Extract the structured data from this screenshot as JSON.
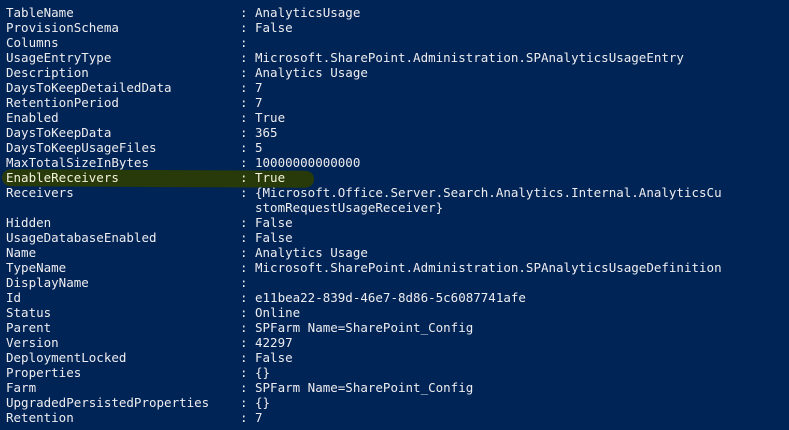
{
  "window": {
    "background": "#012456",
    "text_color": "#eeedf0",
    "highlight_color": "#2a3c06"
  },
  "separator": ":",
  "properties": [
    {
      "key": "TableName",
      "value": "AnalyticsUsage"
    },
    {
      "key": "ProvisionSchema",
      "value": "False"
    },
    {
      "key": "Columns",
      "value": ""
    },
    {
      "key": "UsageEntryType",
      "value": "Microsoft.SharePoint.Administration.SPAnalyticsUsageEntry"
    },
    {
      "key": "Description",
      "value": "Analytics Usage"
    },
    {
      "key": "DaysToKeepDetailedData",
      "value": "7"
    },
    {
      "key": "RetentionPeriod",
      "value": "7"
    },
    {
      "key": "Enabled",
      "value": "True"
    },
    {
      "key": "DaysToKeepData",
      "value": "365"
    },
    {
      "key": "DaysToKeepUsageFiles",
      "value": "5"
    },
    {
      "key": "MaxTotalSizeInBytes",
      "value": "10000000000000"
    },
    {
      "key": "EnableReceivers",
      "value": "True",
      "highlighted": true
    },
    {
      "key": "Receivers",
      "value": "{Microsoft.Office.Server.Search.Analytics.Internal.AnalyticsCu\nstomRequestUsageReceiver}"
    },
    {
      "key": "Hidden",
      "value": "False"
    },
    {
      "key": "UsageDatabaseEnabled",
      "value": "False"
    },
    {
      "key": "Name",
      "value": "Analytics Usage"
    },
    {
      "key": "TypeName",
      "value": "Microsoft.SharePoint.Administration.SPAnalyticsUsageDefinition"
    },
    {
      "key": "DisplayName",
      "value": ""
    },
    {
      "key": "Id",
      "value": "e11bea22-839d-46e7-8d86-5c6087741afe"
    },
    {
      "key": "Status",
      "value": "Online"
    },
    {
      "key": "Parent",
      "value": "SPFarm Name=SharePoint_Config"
    },
    {
      "key": "Version",
      "value": "42297"
    },
    {
      "key": "DeploymentLocked",
      "value": "False"
    },
    {
      "key": "Properties",
      "value": "{}"
    },
    {
      "key": "Farm",
      "value": "SPFarm Name=SharePoint_Config"
    },
    {
      "key": "UpgradedPersistedProperties",
      "value": "{}"
    },
    {
      "key": "Retention",
      "value": "7"
    }
  ]
}
